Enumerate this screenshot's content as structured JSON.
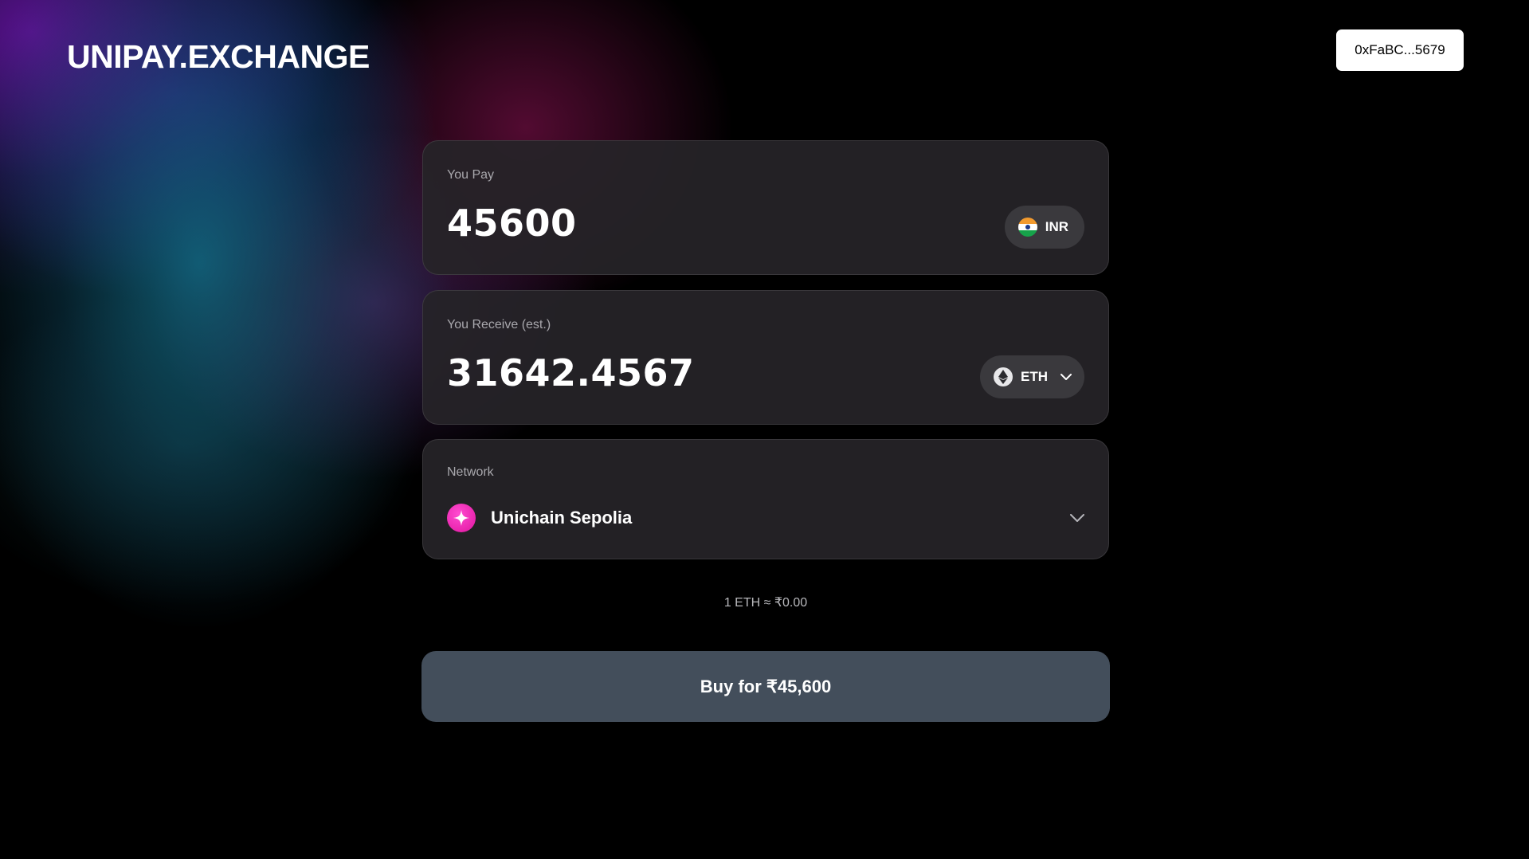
{
  "header": {
    "logo": "UNIPAY.EXCHANGE",
    "wallet_address": "0xFaBC...5679"
  },
  "pay": {
    "label": "You Pay",
    "amount": "45600",
    "currency": "INR",
    "currency_icon": "india-flag-icon"
  },
  "receive": {
    "label": "You Receive (est.)",
    "amount": "31642.4567",
    "token": "ETH",
    "token_icon": "ethereum-icon"
  },
  "network": {
    "label": "Network",
    "selected": "Unichain Sepolia",
    "icon": "unichain-icon"
  },
  "rate_text": "1 ETH ≈ ₹0.00",
  "buy_button_label": "Buy for ₹45,600",
  "colors": {
    "accent_pink": "#e0159f",
    "buy_button": "#434e5b",
    "card_bg": "#262428"
  }
}
